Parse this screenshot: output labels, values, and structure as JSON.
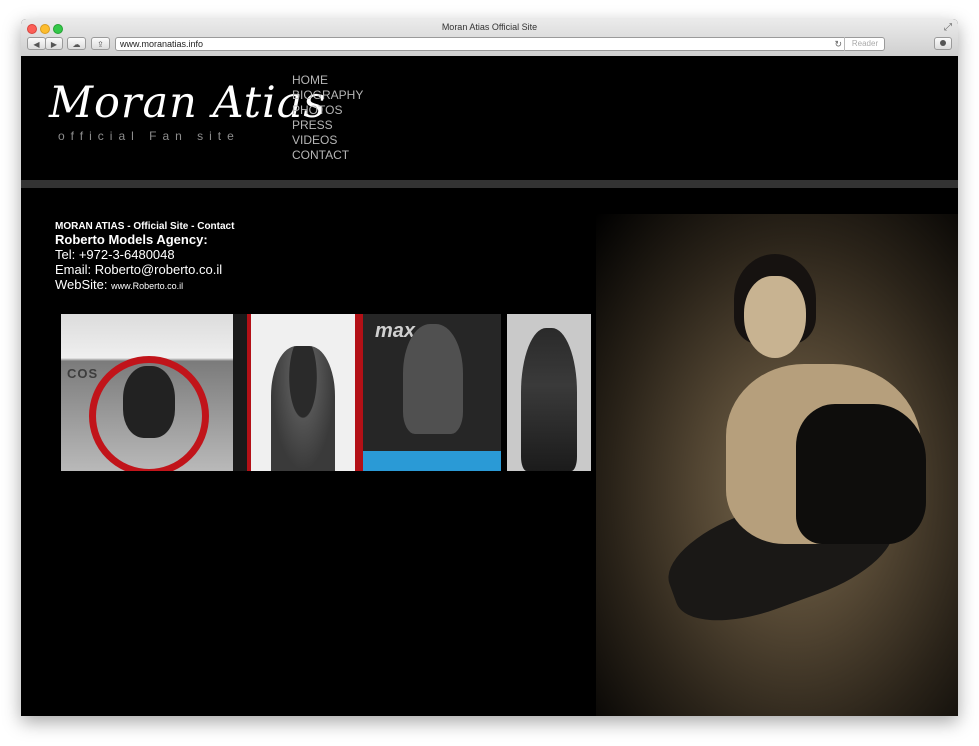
{
  "browser": {
    "window_title": "Moran Atias Official Site",
    "url": "www.moranatias.info",
    "reader_label": "Reader",
    "back_glyph": "◀",
    "forward_glyph": "▶",
    "reload_glyph": "↻",
    "share_glyph": "⇪",
    "icloud_glyph": "☁",
    "fullscreen_glyph": "⤢"
  },
  "site": {
    "logo_title": "Moran Atias",
    "logo_subtitle": "official Fan site",
    "nav": [
      "HOME",
      "BIOGRAPHY",
      "PHOTOS",
      "PRESS",
      "VIDEOS",
      "CONTACT"
    ]
  },
  "contact": {
    "heading": "MORAN ATIAS - Official Site - Contact",
    "agency": "Roberto Models Agency:",
    "tel": "Tel: +972-3-6480048",
    "email": "Email: Roberto@roberto.co.il",
    "website_label": "WebSite:",
    "website_value": "www.Roberto.co.il"
  },
  "collage": {
    "cover_text": "COS",
    "magazine_text": "max"
  },
  "colors": {
    "page_bg": "#000000",
    "nav_text": "#b6b6b6",
    "divider": "#333333",
    "accent_red": "#c1141a",
    "accent_blue": "#2a9ad6"
  },
  "icons": [
    "close-icon",
    "minimize-icon",
    "maximize-icon",
    "back-icon",
    "forward-icon",
    "icloud-icon",
    "share-icon",
    "reload-icon",
    "downloads-icon",
    "fullscreen-icon"
  ]
}
